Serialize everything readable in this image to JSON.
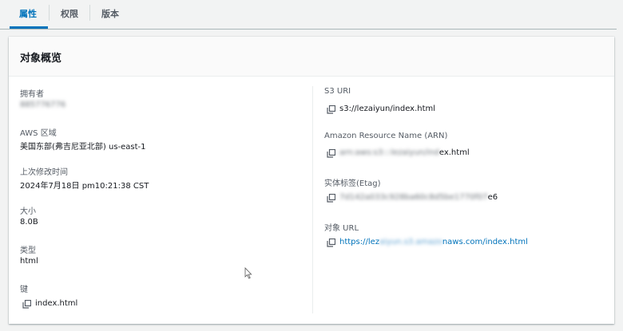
{
  "tabs": [
    {
      "label": "属性",
      "active": true
    },
    {
      "label": "权限",
      "active": false
    },
    {
      "label": "版本",
      "active": false
    }
  ],
  "panel": {
    "title": "对象概览",
    "left": {
      "owner_label": "拥有者",
      "owner_value": "885776776",
      "region_label": "AWS 区域",
      "region_value": "美国东部(弗吉尼亚北部) us-east-1",
      "modified_label": "上次修改时间",
      "modified_value": "2024年7月18日 pm10:21:38 CST",
      "size_label": "大小",
      "size_value": "8.0B",
      "type_label": "类型",
      "type_value": "html",
      "key_label": "键",
      "key_value": "index.html"
    },
    "right": {
      "s3uri_label": "S3 URI",
      "s3uri_value": "s3://lezaiyun/index.html",
      "arn_label": "Amazon Resource Name (ARN)",
      "arn_blur": "arn:aws:s3:::lezaiyun/ind",
      "arn_clear": "ex.html",
      "etag_label": "实体标签(Etag)",
      "etag_blur": "7d142a033c928ba60c8d5be1770f07",
      "etag_clear": "e6",
      "url_label": "对象 URL",
      "url_prefix": "https://lez",
      "url_blur": "aiyun.s3.amazo",
      "url_suffix": "naws.com/index.html"
    }
  },
  "colors": {
    "accent": "#0073bb",
    "label": "#545b64",
    "text": "#16191f"
  }
}
